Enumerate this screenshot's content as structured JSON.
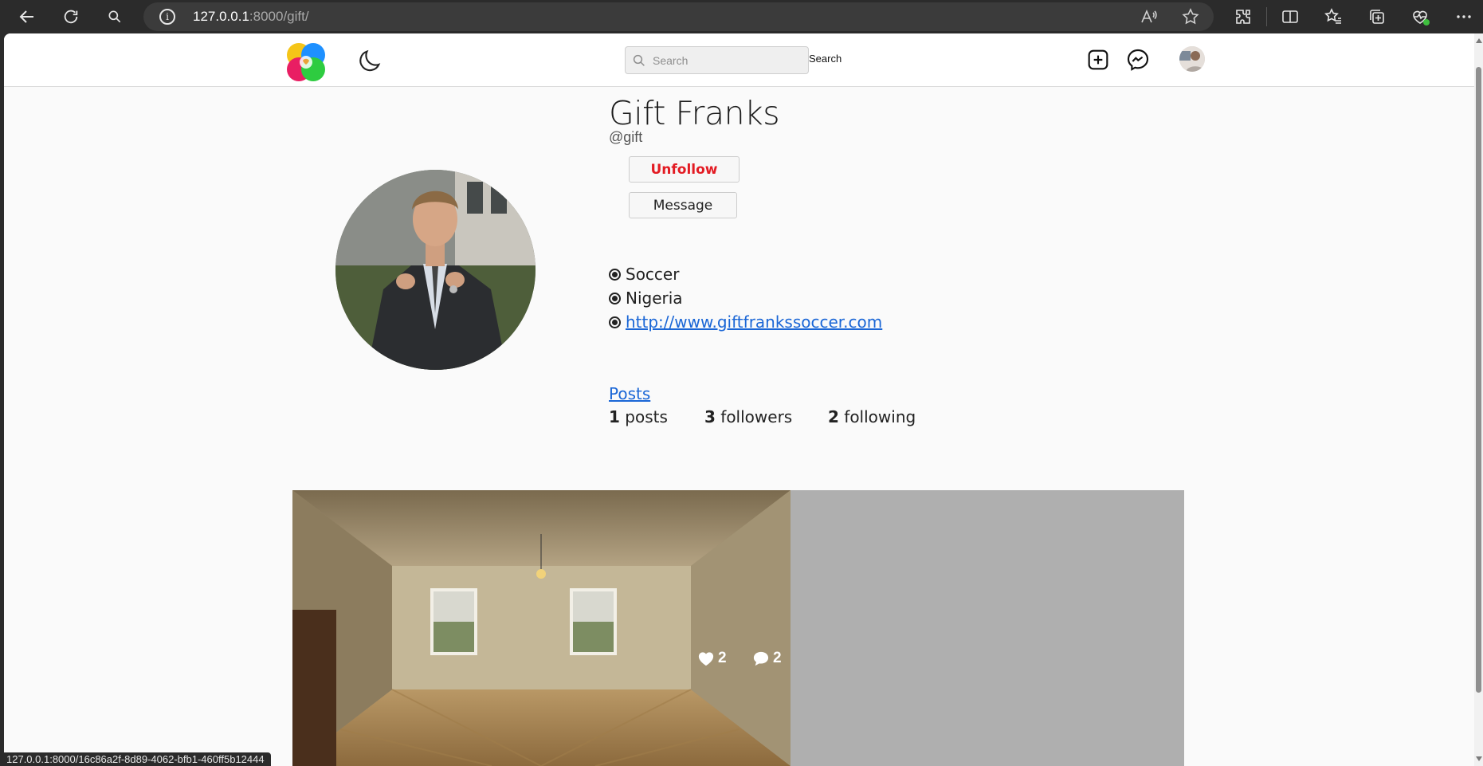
{
  "browser": {
    "url_host": "127.0.0.1",
    "url_rest": ":8000/gift/",
    "status_url": "127.0.0.1:8000/16c86a2f-8d89-4062-bfb1-460ff5b12444"
  },
  "header": {
    "search_placeholder": "Search",
    "search_button": "Search"
  },
  "profile": {
    "name": "Gift Franks",
    "handle": "@gift",
    "unfollow_label": "Unfollow",
    "message_label": "Message",
    "bio": [
      {
        "text": "Soccer"
      },
      {
        "text": "Nigeria"
      },
      {
        "text": "http://www.giftfrankssoccer.com"
      }
    ],
    "posts_link": "Posts",
    "stats": {
      "posts_count": "1",
      "posts_label": "posts",
      "followers_count": "3",
      "followers_label": "followers",
      "following_count": "2",
      "following_label": "following"
    }
  },
  "posts": [
    {
      "likes": "2",
      "comments": "2"
    }
  ],
  "colors": {
    "accent_link": "#1a66d6",
    "unfollow": "#e31b23"
  }
}
